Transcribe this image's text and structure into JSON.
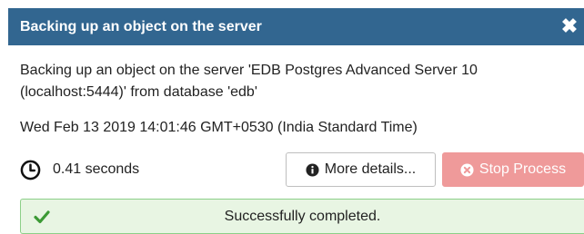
{
  "dialog": {
    "title": "Backing up an object on the server",
    "close_icon": "close-icon"
  },
  "message": {
    "description": "Backing up an object on the server 'EDB Postgres Advanced Server 10 (localhost:5444)' from database 'edb'",
    "timestamp": "Wed Feb 13 2019 14:01:46 GMT+0530 (India Standard Time)"
  },
  "timer": {
    "icon": "clock-icon",
    "elapsed": "0.41 seconds"
  },
  "actions": {
    "more_details_label": "More details...",
    "more_details_icon": "info-circle-icon",
    "stop_label": "Stop Process",
    "stop_icon": "times-circle-icon",
    "stop_enabled": false
  },
  "status": {
    "icon": "check-icon",
    "text": "Successfully completed.",
    "color": "#e8f5e3"
  },
  "colors": {
    "titlebar": "#326690",
    "success_border": "#8ccf88",
    "success_check": "#3c9a35",
    "stop_button": "#ef9a9a"
  }
}
